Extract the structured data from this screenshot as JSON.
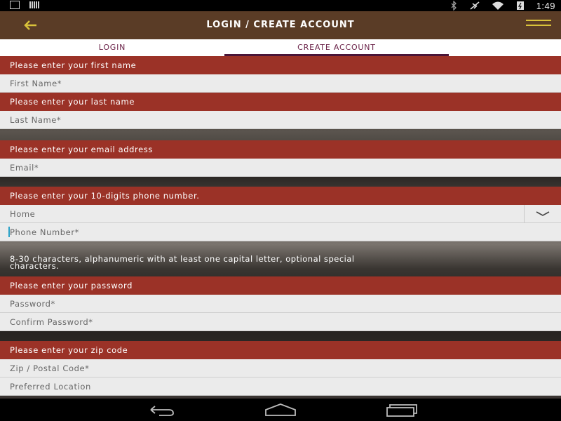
{
  "status_bar": {
    "time": "1:49",
    "icons": [
      "download-icon",
      "bars-icon",
      "bluetooth-icon",
      "airplane-icon",
      "wifi-icon",
      "battery-icon"
    ]
  },
  "app_bar": {
    "title": "LOGIN / CREATE ACCOUNT",
    "accent_color": "#d9c23a"
  },
  "tabs": [
    {
      "label": "LOGIN",
      "active": false
    },
    {
      "label": "CREATE ACCOUNT",
      "active": true
    }
  ],
  "form": {
    "first_name": {
      "banner": "Please enter your first name",
      "placeholder": "First Name*"
    },
    "last_name": {
      "banner": "Please enter your last name",
      "placeholder": "Last Name*"
    },
    "email": {
      "banner": "Please enter your email address",
      "placeholder": "Email*"
    },
    "phone": {
      "banner": "Please enter your 10-digits phone number.",
      "type_value": "Home",
      "placeholder": "Phone Number*"
    },
    "password": {
      "hint_line1": "8-30 characters, alphanumeric with at least one capital letter, optional special",
      "hint_line2": "characters.",
      "banner": "Please enter your password",
      "placeholder": "Password*",
      "confirm_placeholder": "Confirm Password*"
    },
    "zip": {
      "banner": "Please enter your zip code",
      "placeholder": "Zip / Postal Code*",
      "location_placeholder": "Preferred Location"
    }
  },
  "colors": {
    "banner": "#9b3227",
    "app_bar": "#5a3c26",
    "tab_text": "#6a2248"
  }
}
